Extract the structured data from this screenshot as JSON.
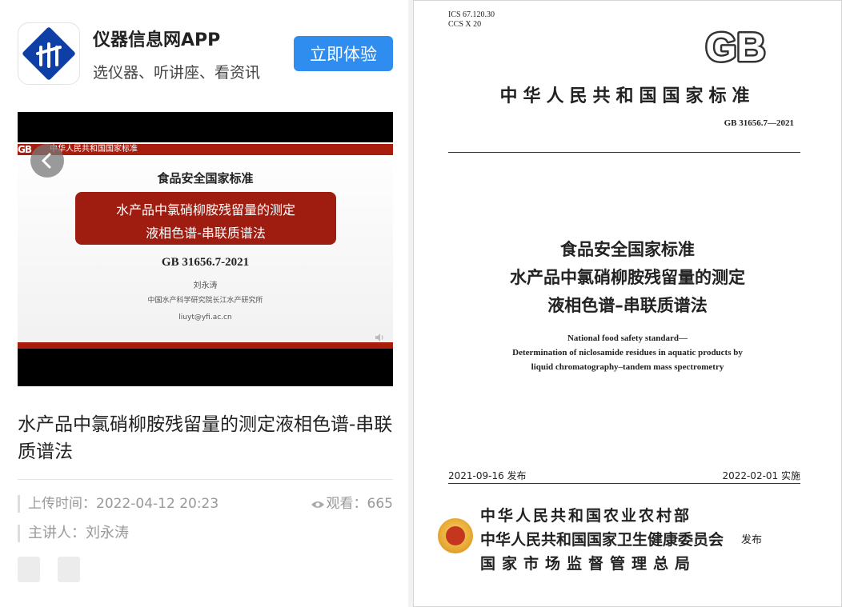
{
  "app_banner": {
    "name": "仪器信息网APP",
    "slogan": "选仪器、听讲座、看资讯",
    "button_label": "立即体验"
  },
  "video": {
    "slide": {
      "header_logo": "GB",
      "header_text": "中华人民共和国国家标准",
      "standard_heading": "食品安全国家标准",
      "title_line1": "水产品中氯硝柳胺残留量的测定",
      "title_line2": "液相色谱-串联质谱法",
      "code": "GB 31656.7-2021",
      "presenter": "刘永涛",
      "institution": "中国水产科学研究院长江水产研究所",
      "email": "liuyt@yfi.ac.cn"
    },
    "title": "水产品中氯硝柳胺残留量的测定液相色谱-串联质谱法",
    "upload_time_label": "上传时间：",
    "upload_time": "2022-04-12 20:23",
    "views_label": "观看：",
    "views": "665",
    "speaker_label": "主讲人：",
    "speaker": "刘永涛"
  },
  "cover": {
    "ics": "ICS 67.120.30",
    "ccs": "CCS X 20",
    "gb_logo": "GB",
    "national_standard": "中华人民共和国国家标准",
    "code": "GB 31656.7—2021",
    "title_cn_1": "食品安全国家标准",
    "title_cn_2": "水产品中氯硝柳胺残留量的测定",
    "title_cn_3": "液相色谱–串联质谱法",
    "title_en_1": "National food safety standard—",
    "title_en_2": "Determination of niclosamide residues in aquatic products by",
    "title_en_3": "liquid chromatography–tandem mass spectrometry",
    "publish_date": "2021-09-16 发布",
    "implement_date": "2022-02-01 实施",
    "org_1": "中华人民共和国农业农村部",
    "org_2": "中华人民共和国国家卫生健康委员会",
    "org_3": "国家市场监督管理总局",
    "publish_label": "发布"
  },
  "colors": {
    "accent_blue": "#2f8df0",
    "slide_red": "#9e1c10",
    "logo_blue": "#0d3fa6"
  }
}
